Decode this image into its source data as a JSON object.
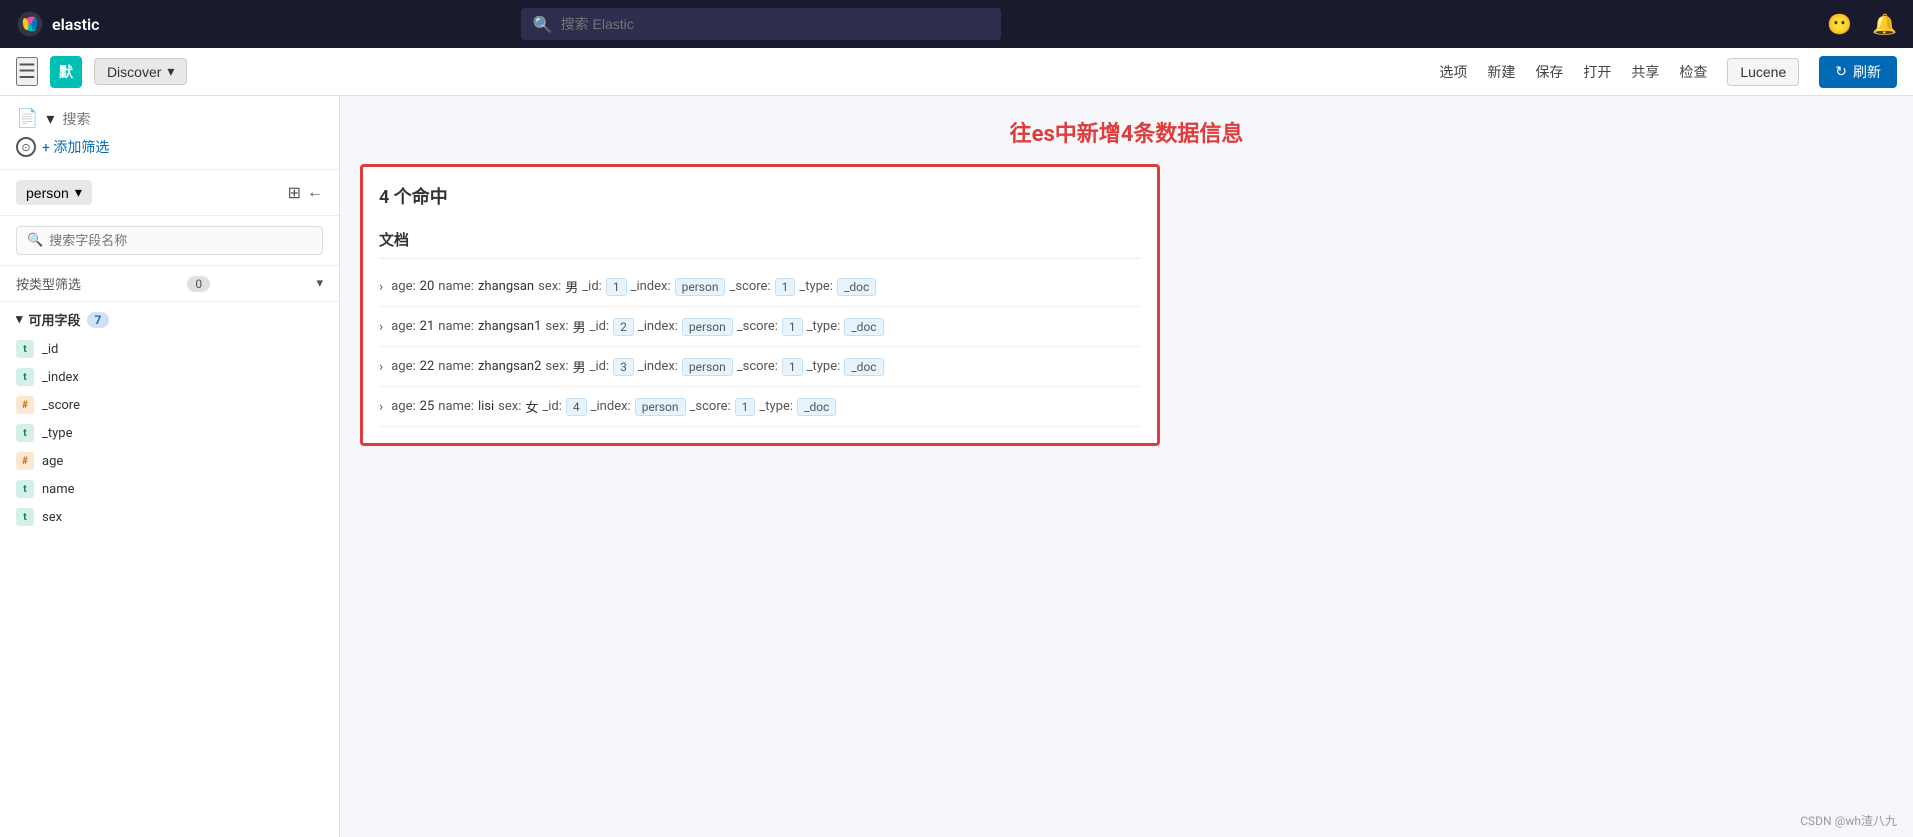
{
  "topNav": {
    "logoText": "elastic",
    "searchPlaceholder": "搜索 Elastic",
    "icons": [
      "help-icon",
      "user-icon"
    ]
  },
  "secondNav": {
    "avatarLabel": "默",
    "discoverLabel": "Discover",
    "chevronLabel": "▾",
    "actions": [
      "选项",
      "新建",
      "保存",
      "打开",
      "共享",
      "检查"
    ],
    "luceneLabel": "Lucene",
    "refreshLabel": "刷新",
    "refreshIcon": "↻"
  },
  "sidebar": {
    "searchPlaceholder": "搜索",
    "filterAddLabel": "+ 添加筛选",
    "indexPattern": "person",
    "fieldSearchPlaceholder": "搜索字段名称",
    "filterTypeLabel": "按类型筛选",
    "filterTypeCount": "0",
    "availableFieldsLabel": "可用字段",
    "availableFieldsCount": "7",
    "fields": [
      {
        "name": "_id",
        "type": "t"
      },
      {
        "name": "_index",
        "type": "t"
      },
      {
        "name": "_score",
        "type": "#"
      },
      {
        "name": "_type",
        "type": "t"
      },
      {
        "name": "age",
        "type": "#"
      },
      {
        "name": "name",
        "type": "t"
      },
      {
        "name": "sex",
        "type": "t"
      }
    ]
  },
  "content": {
    "annotation": "往es中新增4条数据信息",
    "resultsCount": "4 个命中",
    "tableHeader": "文档",
    "documents": [
      {
        "age": "20",
        "name": "zhangsan",
        "sex": "男",
        "_id": "1",
        "_index": "person",
        "_score": "1",
        "_type": "_doc"
      },
      {
        "age": "21",
        "name": "zhangsan1",
        "sex": "男",
        "_id": "2",
        "_index": "person",
        "_score": "1",
        "_type": "_doc"
      },
      {
        "age": "22",
        "name": "zhangsan2",
        "sex": "男",
        "_id": "3",
        "_index": "person",
        "_score": "1",
        "_type": "_doc"
      },
      {
        "age": "25",
        "name": "lisi",
        "sex": "女",
        "_id": "4",
        "_index": "person",
        "_score": "1",
        "_type": "_doc"
      }
    ]
  },
  "watermark": "CSDN @wh渣八九"
}
